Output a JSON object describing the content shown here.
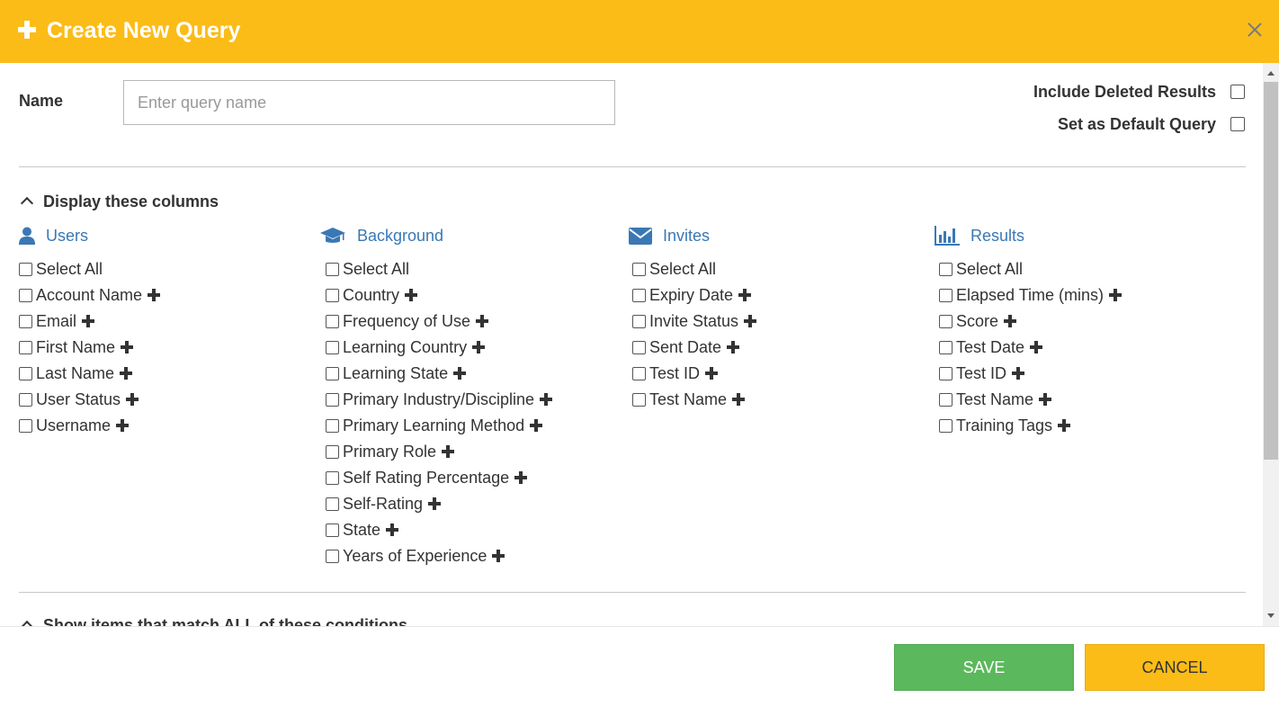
{
  "dialog": {
    "title": "Create New Query",
    "accent_color": "#fbbc17",
    "icons": {
      "header": "plus-icon",
      "close": "close-icon"
    }
  },
  "name_field": {
    "label": "Name",
    "placeholder": "Enter query name",
    "value": ""
  },
  "options": [
    {
      "label": "Include Deleted Results",
      "checked": false
    },
    {
      "label": "Set as Default Query",
      "checked": false
    }
  ],
  "display_section": {
    "title": "Display these columns",
    "expanded": true,
    "columns": [
      {
        "heading": "Users",
        "icon": "user-icon",
        "items": [
          "Select All",
          "Account Name",
          "Email",
          "First Name",
          "Last Name",
          "User Status",
          "Username"
        ]
      },
      {
        "heading": "Background",
        "icon": "graduation-cap-icon",
        "items": [
          "Select All",
          "Country",
          "Frequency of Use",
          "Learning Country",
          "Learning State",
          "Primary Industry/Discipline",
          "Primary Learning Method",
          "Primary Role",
          "Self Rating Percentage",
          "Self-Rating",
          "State",
          "Years of Experience"
        ]
      },
      {
        "heading": "Invites",
        "icon": "envelope-icon",
        "items": [
          "Select All",
          "Expiry Date",
          "Invite Status",
          "Sent Date",
          "Test ID",
          "Test Name"
        ]
      },
      {
        "heading": "Results",
        "icon": "bar-chart-icon",
        "items": [
          "Select All",
          "Elapsed Time (mins)",
          "Score",
          "Test Date",
          "Test ID",
          "Test Name",
          "Training Tags"
        ]
      }
    ]
  },
  "conditions_section": {
    "title": "Show items that match ALL of these conditions"
  },
  "footer": {
    "save_label": "SAVE",
    "cancel_label": "CANCEL",
    "save_color": "#5cb85c",
    "cancel_color": "#fbbc17"
  }
}
